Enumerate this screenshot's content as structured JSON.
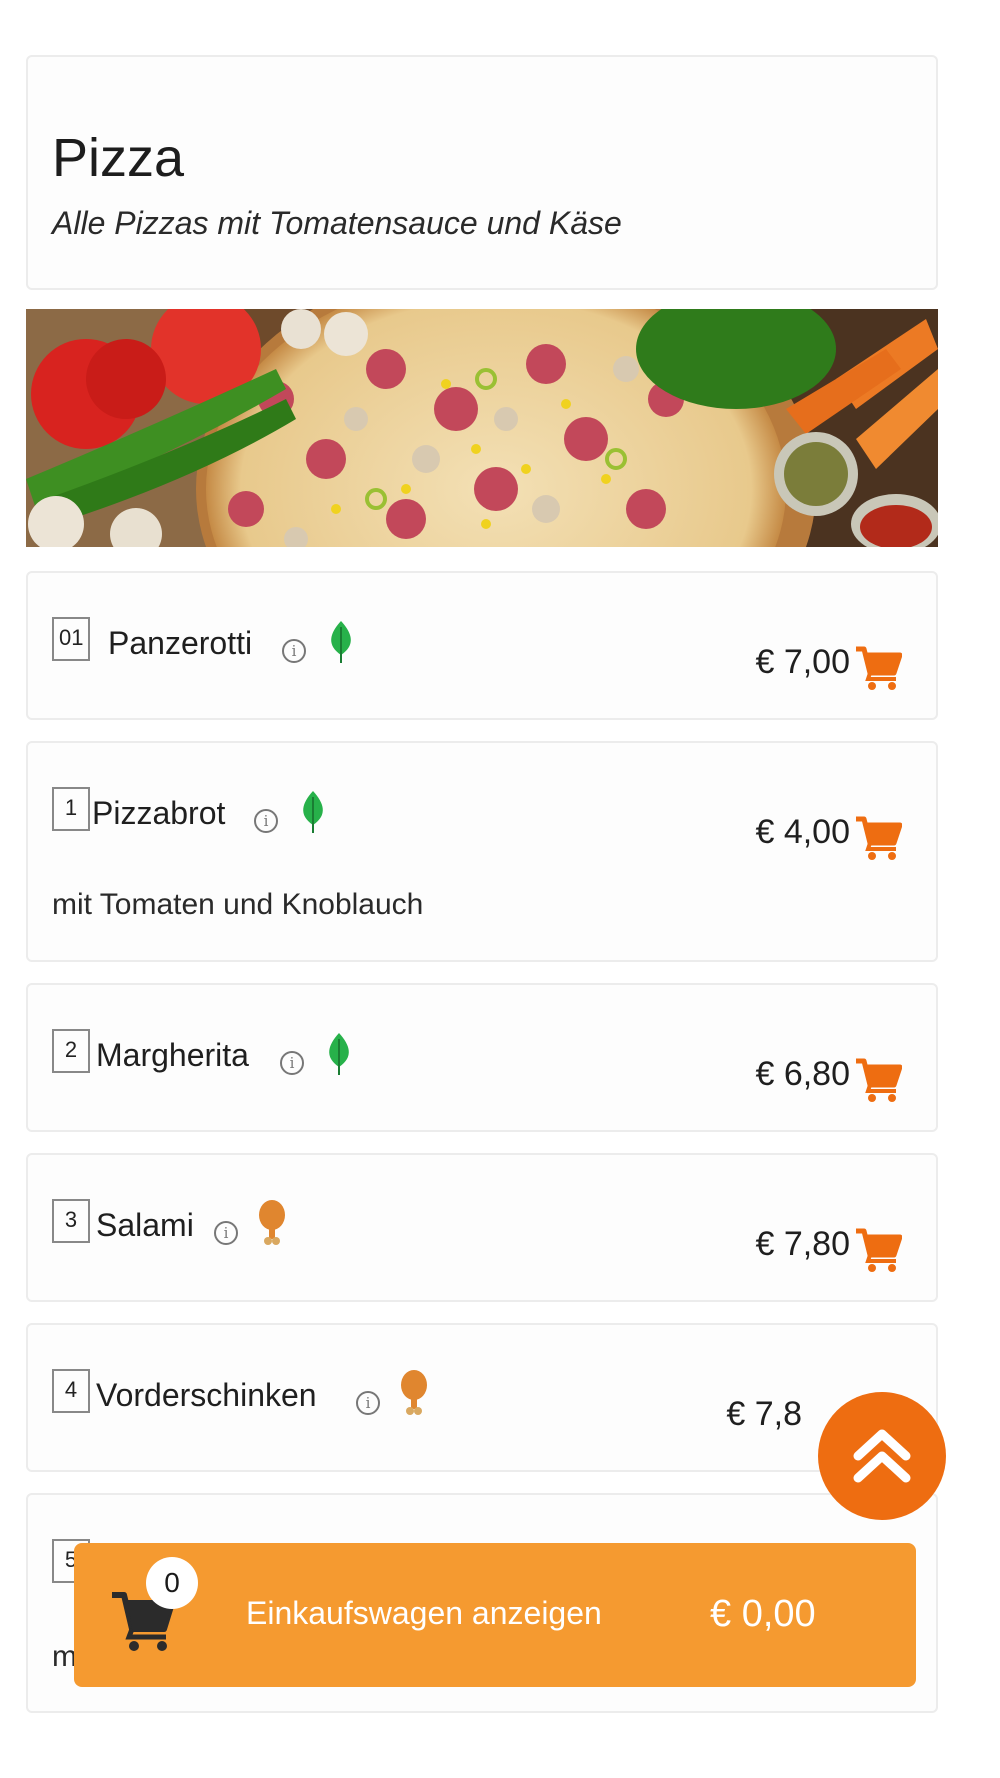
{
  "category": {
    "title": "Pizza",
    "subtitle": "Alle Pizzas mit Tomatensauce und Käse"
  },
  "items": [
    {
      "number": "01",
      "name": "Panzerotti",
      "badge": "leaf-icon",
      "price": "€ 7,00",
      "description": ""
    },
    {
      "number": "1",
      "name": "Pizzabrot",
      "badge": "leaf-icon",
      "price": "€ 4,00",
      "description": "mit Tomaten und Knoblauch"
    },
    {
      "number": "2",
      "name": "Margherita",
      "badge": "leaf-icon",
      "price": "€ 6,80",
      "description": ""
    },
    {
      "number": "3",
      "name": "Salami",
      "badge": "drumstick-icon",
      "price": "€ 7,80",
      "description": ""
    },
    {
      "number": "4",
      "name": "Vorderschinken",
      "badge": "drumstick-icon",
      "price": "€ 7,8",
      "description": ""
    },
    {
      "number": "5",
      "name": "",
      "badge": "leaf-icon",
      "price": "",
      "description": "m"
    }
  ],
  "cart": {
    "count": "0",
    "label": "Einkaufswagen anzeigen",
    "total": "€ 0,00"
  },
  "colors": {
    "accent": "#ee6d11",
    "cart_bar": "#f59a30",
    "leaf": "#27b14a",
    "drumstick": "#e0862f"
  }
}
